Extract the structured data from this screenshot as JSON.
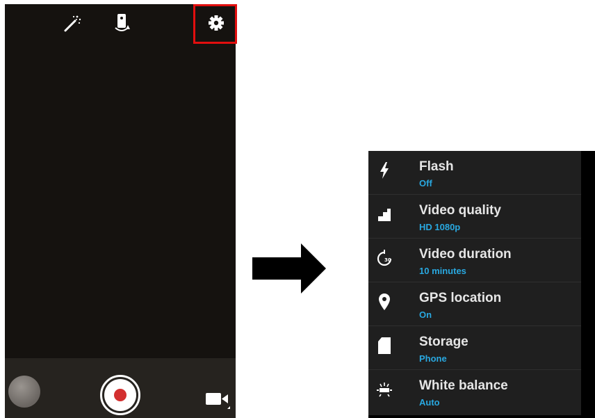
{
  "camera": {
    "icons": [
      "magic-wand-icon",
      "switch-camera-icon",
      "gear-icon",
      "video-camera-icon"
    ],
    "record_color": "#d32f2f",
    "highlight_color": "#e10e0e"
  },
  "settings": {
    "items": [
      {
        "icon": "flash-icon",
        "title": "Flash",
        "value": "Off"
      },
      {
        "icon": "video-quality-icon",
        "title": "Video quality",
        "value": "HD 1080p"
      },
      {
        "icon": "timer-icon",
        "title": "Video duration",
        "value": "10 minutes"
      },
      {
        "icon": "location-pin-icon",
        "title": "GPS location",
        "value": "On"
      },
      {
        "icon": "sd-card-icon",
        "title": "Storage",
        "value": "Phone"
      },
      {
        "icon": "white-balance-icon",
        "title": "White balance",
        "value": "Auto"
      }
    ],
    "accent_color": "#29a8e0"
  }
}
